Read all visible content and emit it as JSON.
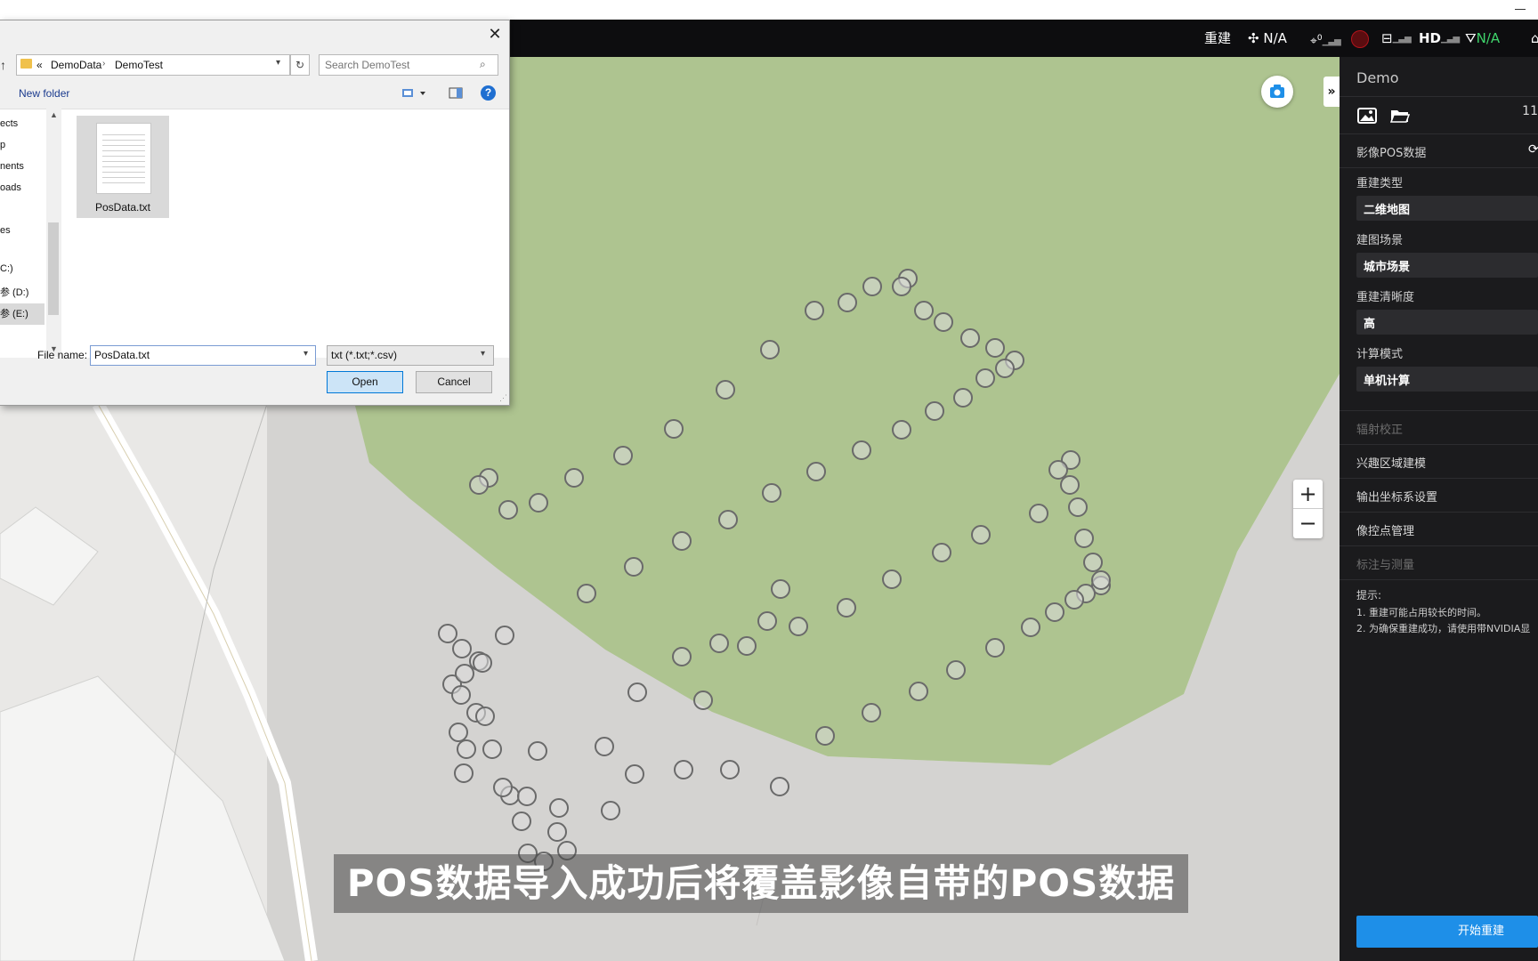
{
  "topbar": {
    "mode_label": "重建",
    "drone_status": "N/A",
    "satellite_count": "0",
    "hd_label": "HD",
    "rtk_status": "N/A"
  },
  "panel": {
    "project_name": "Demo",
    "image_count": "11",
    "pos_section": "影像POS数据",
    "recon_type_label": "重建类型",
    "recon_type_value": "二维地图",
    "scene_label": "建图场景",
    "scene_value": "城市场景",
    "clarity_label": "重建清晰度",
    "clarity_value": "高",
    "compute_label": "计算模式",
    "compute_value": "单机计算",
    "items": [
      "辐射校正",
      "兴趣区域建模",
      "输出坐标系设置",
      "像控点管理",
      "标注与测量"
    ],
    "tips_title": "提示:",
    "tips": [
      "1. 重建可能占用较长的时间。",
      "2. 为确保重建成功，请使用带NVIDIA显"
    ],
    "start_button": "开始重建"
  },
  "caption": "POS数据导入成功后将覆盖影像自带的POS数据",
  "dialog": {
    "breadcrumb_prefix": "«",
    "breadcrumb": [
      "DemoData",
      "DemoTest"
    ],
    "search_placeholder": "Search DemoTest",
    "new_folder": "New folder",
    "nav_items": [
      "ects",
      "p",
      "nents",
      "oads",
      "",
      "es",
      "C:)",
      "参 (D:)",
      "参 (E:)"
    ],
    "file_name": "PosData.txt",
    "file_name_label": "File name:",
    "file_name_value": "PosData.txt",
    "file_type": "txt (*.txt;*.csv)",
    "open_button": "Open",
    "cancel_button": "Cancel"
  },
  "colors": {
    "map_green": "#aec490",
    "map_gray": "#d4d3d1",
    "panel_bg": "#1b1b1d",
    "accent_blue": "#1e8fe8",
    "rtk_green": "#3fd46b"
  }
}
